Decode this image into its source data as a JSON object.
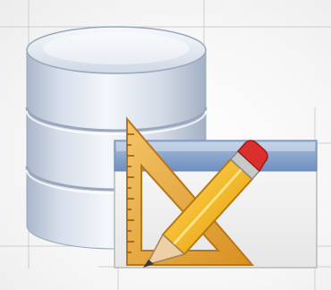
{
  "icon": {
    "name": "database-design-icon",
    "components": [
      "database-icon",
      "window-icon",
      "set-square-icon",
      "pencil-icon"
    ]
  },
  "colors": {
    "database_light": "#e9eef6",
    "database_mid": "#c6d1e2",
    "database_dark": "#8f9fb8",
    "window_titlebar": "#7f9dc8",
    "window_body": "#f3f3f3",
    "set_square": "#e3a63a",
    "pencil_body": "#f6c542",
    "pencil_tip": "#e8c9a0",
    "pencil_eraser": "#d9302e",
    "guide_lines": "#c9c9c9"
  }
}
